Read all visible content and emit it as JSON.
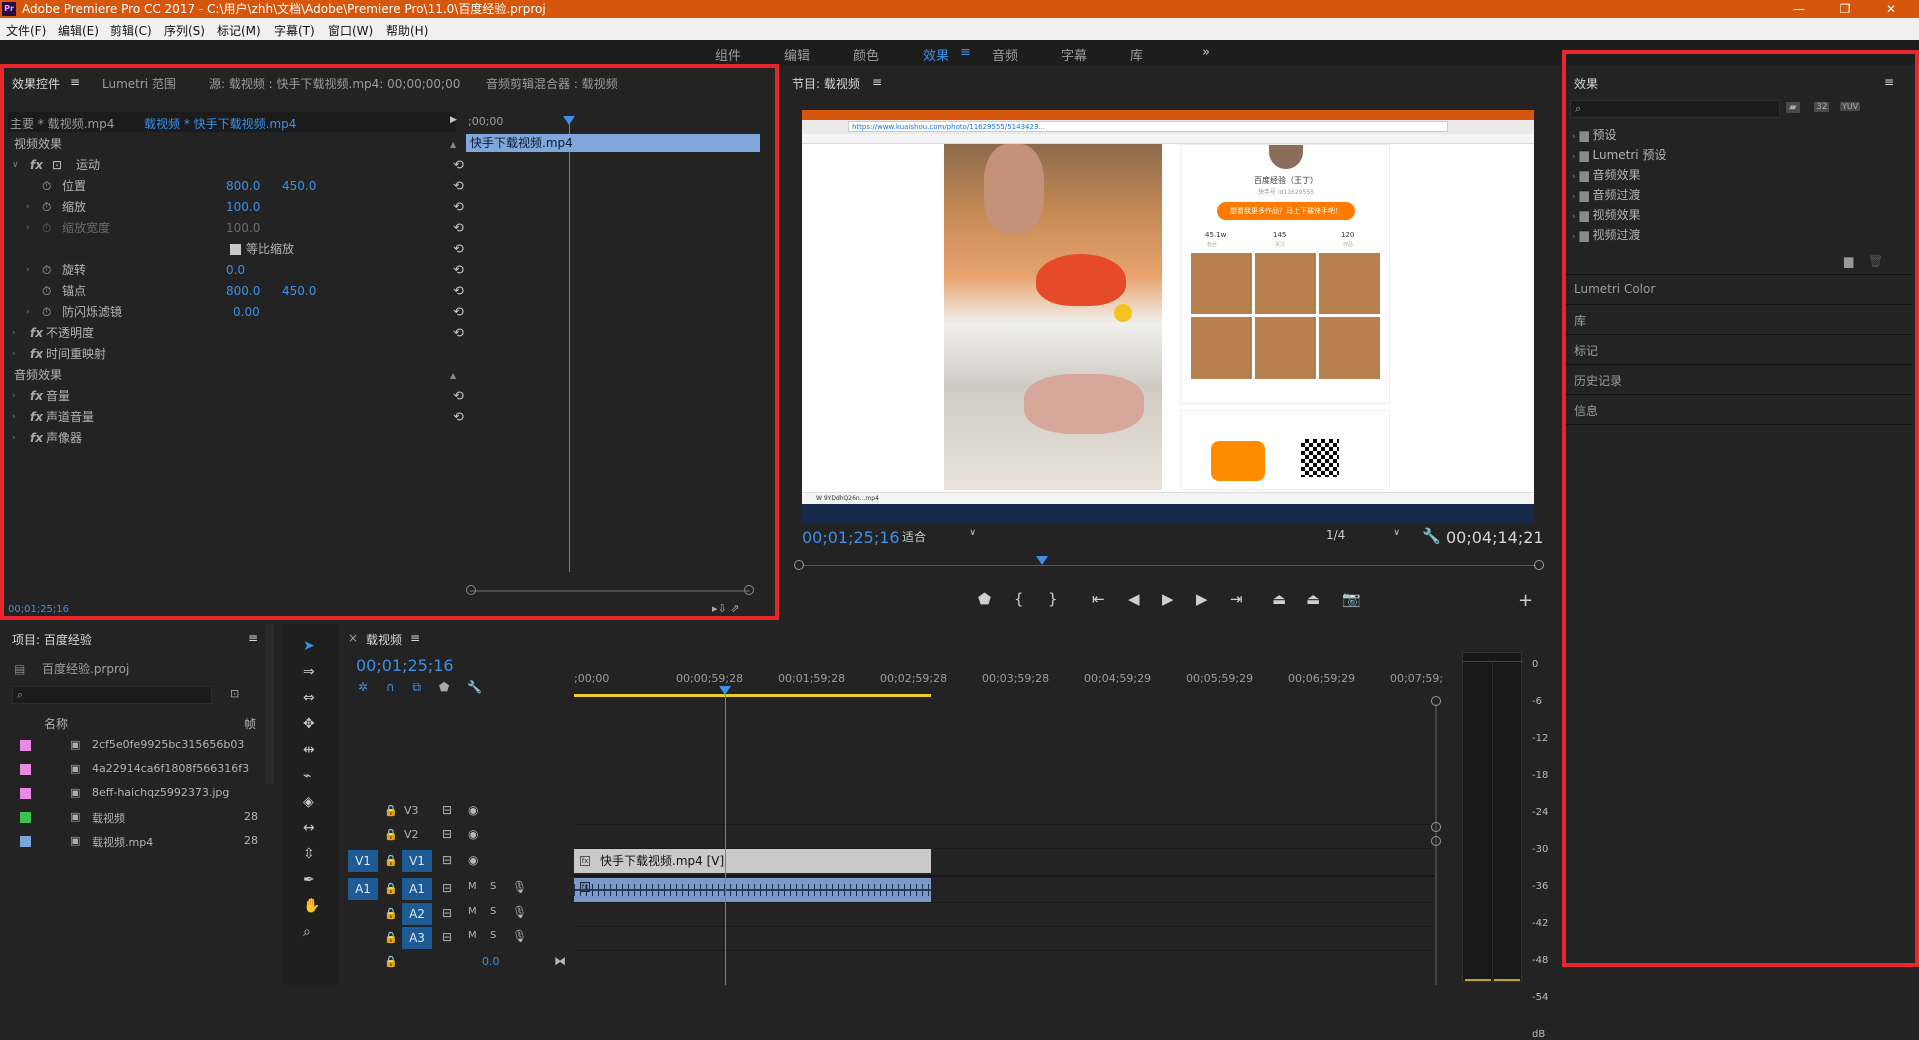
{
  "app": {
    "title": "Adobe Premiere Pro CC 2017 - C:\\用户\\zhh\\文档\\Adobe\\Premiere Pro\\11.0\\百度经验.prproj",
    "logo": "Pr",
    "win": [
      "—",
      "❐",
      "✕"
    ]
  },
  "menu": [
    "文件(F)",
    "编辑(E)",
    "剪辑(C)",
    "序列(S)",
    "标记(M)",
    "字幕(T)",
    "窗口(W)",
    "帮助(H)"
  ],
  "workspaces": [
    "组件",
    "编辑",
    "颜色",
    "效果",
    "音频",
    "字幕",
    "库"
  ],
  "ws_more": "»",
  "fxpanel": {
    "tabs": [
      "效果控件",
      "Lumetri 范围",
      "源: 载视频 : 快手下载视频.mp4: 00;00;00;00",
      "音频剪辑混合器 : 载视频"
    ],
    "master": "主要 * 载视频.mp4",
    "seq": "载视频 * 快手下载视频.mp4",
    "ruler": ";00;00",
    "clip": "快手下载视频.mp4",
    "video_hdr": "视频效果",
    "motion": "运动",
    "pos": "位置",
    "pos_x": "800.0",
    "pos_y": "450.0",
    "scale": "缩放",
    "scale_v": "100.0",
    "scalew": "缩放宽度",
    "scalew_v": "100.0",
    "uniform": "等比缩放",
    "rot": "旋转",
    "rot_v": "0.0",
    "anchor": "锚点",
    "anc_x": "800.0",
    "anc_y": "450.0",
    "flicker": "防闪烁滤镜",
    "flicker_v": "0.00",
    "opacity": "不透明度",
    "timemap": "时间重映射",
    "audio_hdr": "音频效果",
    "vol": "音量",
    "chvol": "声道音量",
    "panner": "声像器",
    "tc": "00;01;25;16"
  },
  "program": {
    "title": "节目: 载视频",
    "tc_left": "00;01;25;16",
    "fit": "适合",
    "res": "1/4",
    "tc_right": "00;04;14;21",
    "shot": {
      "url": "https://www.kuaishou.com/photo/11629555/5143423...",
      "name": "百度经验（王丁）",
      "sub": "快手号 id11629555",
      "btn": "想看我更多作品？马上下载快手吧！",
      "stats": [
        "45.1w",
        "145",
        "120"
      ],
      "statlbl": [
        "粉丝",
        "关注",
        "作品"
      ],
      "download": "W 9YDdhQ26n...mp4"
    }
  },
  "effects": {
    "title": "效果",
    "tree": [
      "预设",
      "Lumetri 预设",
      "音频效果",
      "音频过渡",
      "视频效果",
      "视频过渡"
    ],
    "sections": [
      "Lumetri Color",
      "库",
      "标记",
      "历史记录",
      "信息"
    ],
    "badges": [
      "32",
      "YUV"
    ]
  },
  "project": {
    "title": "项目: 百度经验",
    "file": "百度经验.prproj",
    "col_name": "名称",
    "col_fr": "帧",
    "items": [
      {
        "name": "2cf5e0fe9925bc315656b03",
        "color": "#e88be3",
        "fr": ""
      },
      {
        "name": "4a22914ca6f1808f566316f3",
        "color": "#e88be3",
        "fr": ""
      },
      {
        "name": "8eff-haichqz5992373.jpg",
        "color": "#e88be3",
        "fr": ""
      },
      {
        "name": "载视频",
        "color": "#3fbf50",
        "fr": "28"
      },
      {
        "name": "载视频.mp4",
        "color": "#7aa5d8",
        "fr": "28"
      }
    ]
  },
  "timeline": {
    "tab": "载视频",
    "tc": "00;01;25;16",
    "ruler": [
      ";00;00",
      "00;00;59;28",
      "00;01;59;28",
      "00;02;59;28",
      "00;03;59;28",
      "00;04;59;29",
      "00;05;59;29",
      "00;06;59;29",
      "00;07;59;"
    ],
    "tracks": [
      "V3",
      "V2",
      "V1",
      "A1",
      "A2",
      "A3"
    ],
    "vclip": "快手下载视频.mp4 [V]",
    "master_val": "0.0"
  },
  "meter": [
    "0",
    "-6",
    "-12",
    "-18",
    "-24",
    "-30",
    "-36",
    "-42",
    "-48",
    "-54",
    "dB"
  ]
}
